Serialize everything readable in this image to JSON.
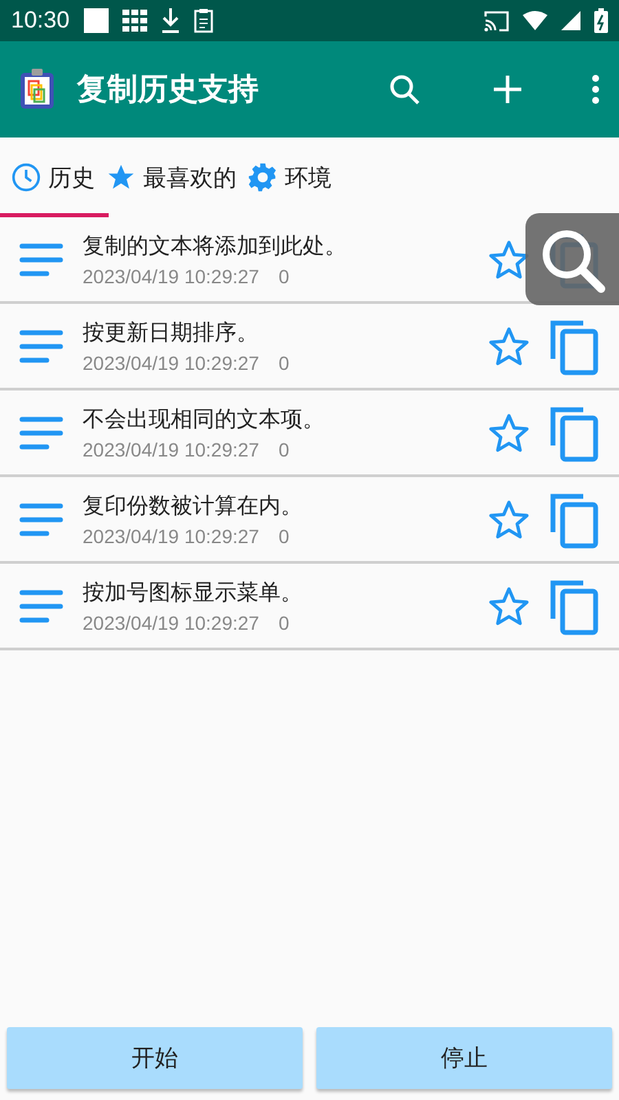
{
  "status_bar": {
    "time": "10:30"
  },
  "app_bar": {
    "title": "复制历史支持"
  },
  "tabs": [
    {
      "label": "历史",
      "kind": "clock",
      "selected": true
    },
    {
      "label": "最喜欢的",
      "kind": "star",
      "selected": false
    },
    {
      "label": "环境",
      "kind": "gear",
      "selected": false
    }
  ],
  "items": [
    {
      "text": "复制的文本将添加到此处。",
      "date": "2023/04/19 10:29:27",
      "count": "0",
      "favorite": false
    },
    {
      "text": "按更新日期排序。",
      "date": "2023/04/19 10:29:27",
      "count": "0",
      "favorite": false
    },
    {
      "text": "不会出现相同的文本项。",
      "date": "2023/04/19 10:29:27",
      "count": "0",
      "favorite": false
    },
    {
      "text": "复印份数被计算在内。",
      "date": "2023/04/19 10:29:27",
      "count": "0",
      "favorite": false
    },
    {
      "text": "按加号图标显示菜单。",
      "date": "2023/04/19 10:29:27",
      "count": "0",
      "favorite": false
    }
  ],
  "buttons": [
    {
      "label": "开始"
    },
    {
      "label": "停止"
    }
  ]
}
